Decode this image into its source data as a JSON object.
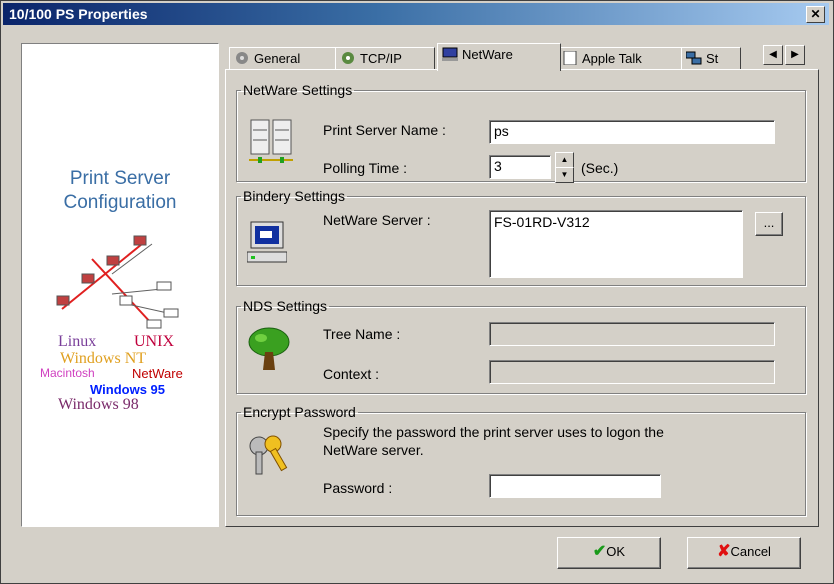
{
  "window": {
    "title": "10/100 PS Properties",
    "close_label": "✕"
  },
  "left_panel": {
    "title_line1": "Print Server",
    "title_line2": "Configuration",
    "os_labels": {
      "linux": "Linux",
      "unix": "UNIX",
      "winnt": "Windows NT",
      "mac": "Macintosh",
      "netware": "NetWare",
      "win95": "Windows 95",
      "win98": "Windows 98"
    },
    "colors": {
      "title": "#3a6ea5",
      "linux": "#7a3f9a",
      "unix": "#c0003c",
      "winnt": "#e0a020",
      "mac": "#d040c0",
      "netware": "#c00000",
      "win95": "#0020ff",
      "win98": "#7a2a6a"
    }
  },
  "tabs": [
    {
      "label": "General",
      "icon": "general-icon",
      "active": false
    },
    {
      "label": "TCP/IP",
      "icon": "tcpip-icon",
      "active": false
    },
    {
      "label": "NetWare",
      "icon": "netware-icon",
      "active": true
    },
    {
      "label": "Apple Talk",
      "icon": "appletalk-icon",
      "active": false
    },
    {
      "label": "St",
      "icon": "snmp-icon",
      "active": false
    }
  ],
  "tab_scroll": {
    "left": "◀",
    "right": "▶"
  },
  "netware_settings": {
    "legend": "NetWare Settings",
    "server_name_label": "Print Server Name :",
    "server_name_value": "ps",
    "polling_label": "Polling Time :",
    "polling_value": "3",
    "polling_unit": "(Sec.)"
  },
  "bindery_settings": {
    "legend": "Bindery Settings",
    "server_label": "NetWare Server :",
    "server_value": "FS-01RD-V312",
    "browse_label": "..."
  },
  "nds_settings": {
    "legend": "NDS Settings",
    "tree_label": "Tree Name :",
    "tree_value": "",
    "context_label": "Context :",
    "context_value": ""
  },
  "encrypt_password": {
    "legend": "Encrypt Password",
    "description_line1": "Specify the password the print server uses to logon the",
    "description_line2": "NetWare server.",
    "password_label": "Password :",
    "password_value": ""
  },
  "footer": {
    "ok_label": "OK",
    "cancel_label": "Cancel",
    "ok_color": "#1a9a1a",
    "cancel_color": "#e01010"
  }
}
